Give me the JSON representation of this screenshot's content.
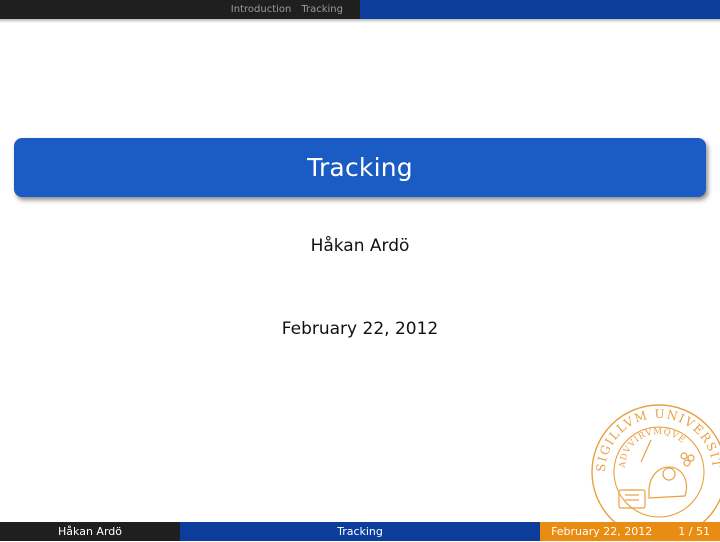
{
  "nav": {
    "items": [
      {
        "label": "Introduction"
      },
      {
        "label": "Tracking"
      }
    ]
  },
  "slide": {
    "title": "Tracking",
    "author": "Håkan Ardö",
    "date": "February 22, 2012"
  },
  "seal": {
    "text": "SIGILLVM UNIVERSITATIS CAROLINAE",
    "inner_text": "ADVVIRVMQVE"
  },
  "footer": {
    "author": "Håkan Ardö",
    "title": "Tracking",
    "date": "February 22, 2012",
    "page": "1 / 51"
  },
  "colors": {
    "nav_dark": "#1f1f1f",
    "nav_blue": "#0c3c9c",
    "title_blue": "#1b5bc4",
    "footer_orange": "#e88c12",
    "seal_orange": "#e8a040"
  }
}
